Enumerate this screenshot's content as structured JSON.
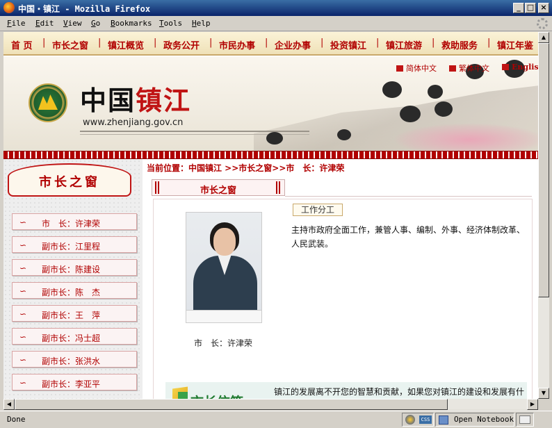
{
  "window": {
    "title": "中国・镇江 - Mozilla Firefox",
    "buttons": {
      "minimize": "_",
      "maximize": "□",
      "close": "×"
    }
  },
  "menubar": {
    "items": [
      {
        "u": "F",
        "rest": "ile"
      },
      {
        "u": "E",
        "rest": "dit"
      },
      {
        "u": "V",
        "rest": "iew"
      },
      {
        "u": "G",
        "rest": "o"
      },
      {
        "u": "B",
        "rest": "ookmarks"
      },
      {
        "u": "T",
        "rest": "ools"
      },
      {
        "u": "H",
        "rest": "elp"
      }
    ]
  },
  "topnav": {
    "items": [
      "首 页",
      "市长之窗",
      "镇江概览",
      "政务公开",
      "市民办事",
      "企业办事",
      "投资镇江",
      "镇江旅游",
      "救助服务",
      "镇江年鉴"
    ],
    "separator": "|"
  },
  "banner": {
    "title_black": "中国",
    "title_red": "镇江",
    "url": "www.zhenjiang.gov.cn",
    "lang": [
      "简体中文",
      "繁体中文",
      "English"
    ]
  },
  "breadcrumb": "当前位置：中国镇江 >>市长之窗>>市　长：许津荣",
  "sidebar": {
    "heading": "市长之窗",
    "bullet": "∽",
    "items": [
      "市　长：许津荣",
      "副市长：江里程",
      "副市长：陈建设",
      "副市长：陈　杰",
      "副市长：王　萍",
      "副市长：冯士超",
      "副市长：张洪水",
      "副市长：李亚平"
    ]
  },
  "main": {
    "tab_title": "市长之窗",
    "duty_label": "工作分工",
    "duty_text": "主持市政府全面工作，兼管人事、编制、外事、经济体制改革、人民武装。",
    "photo_caption": "市　长：许津荣",
    "mailbox_title": "市长信箱",
    "mailbox_text": "镇江的发展离不开您的智慧和贡献，如果您对镇江的建设和发展有什么好的建议和意见，请给我来信。"
  },
  "statusbar": {
    "status": "Done",
    "css_badge": "CSS",
    "open_notebook": "Open Notebook"
  }
}
